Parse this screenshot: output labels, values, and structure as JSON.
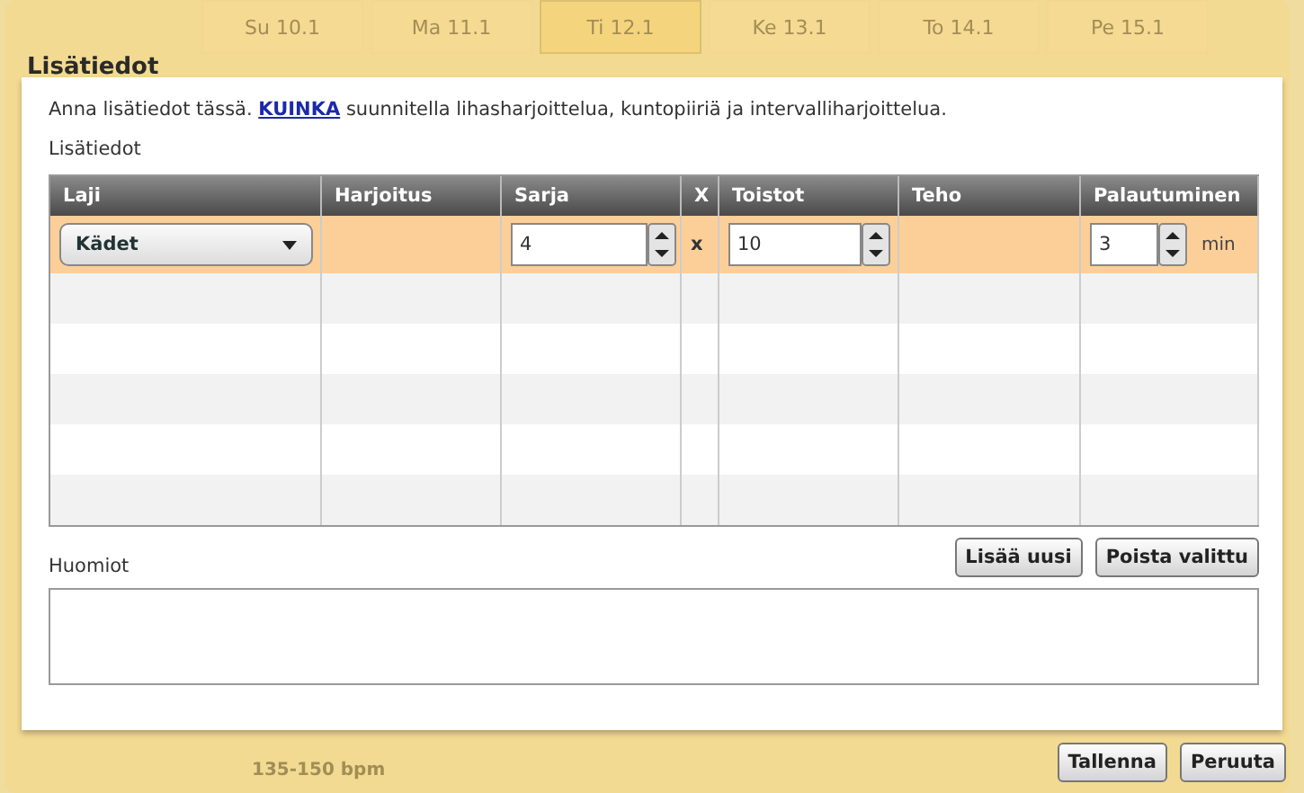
{
  "background": {
    "days": [
      {
        "label": "Su 10.1",
        "selected": false
      },
      {
        "label": "Ma 11.1",
        "selected": false
      },
      {
        "label": "Ti 12.1",
        "selected": true
      },
      {
        "label": "Ke 13.1",
        "selected": false
      },
      {
        "label": "To 14.1",
        "selected": false
      },
      {
        "label": "Pe 15.1",
        "selected": false
      }
    ],
    "footer_text": "135-150 bpm"
  },
  "dialog": {
    "title": "Lisätiedot",
    "intro": {
      "before": "Anna lisätiedot tässä.",
      "link": "KUINKA",
      "after": "suunnitella lihasharjoittelua, kuntopiiriä ja intervalliharjoittelua."
    },
    "section_label": "Lisätiedot",
    "table": {
      "columns": [
        "Laji",
        "Harjoitus",
        "Sarja",
        "X",
        "Toistot",
        "Teho",
        "Palautuminen"
      ],
      "rows": [
        {
          "selected": true,
          "laji": "Kädet",
          "sarja": "4",
          "x": "x",
          "toistot": "10",
          "palautuminen": "3",
          "unit": "min"
        }
      ]
    },
    "notes_label": "Huomiot",
    "table_buttons": [
      "Lisää uusi",
      "Poista valittu"
    ],
    "footer_buttons": [
      "Tallenna",
      "Peruuta"
    ]
  }
}
